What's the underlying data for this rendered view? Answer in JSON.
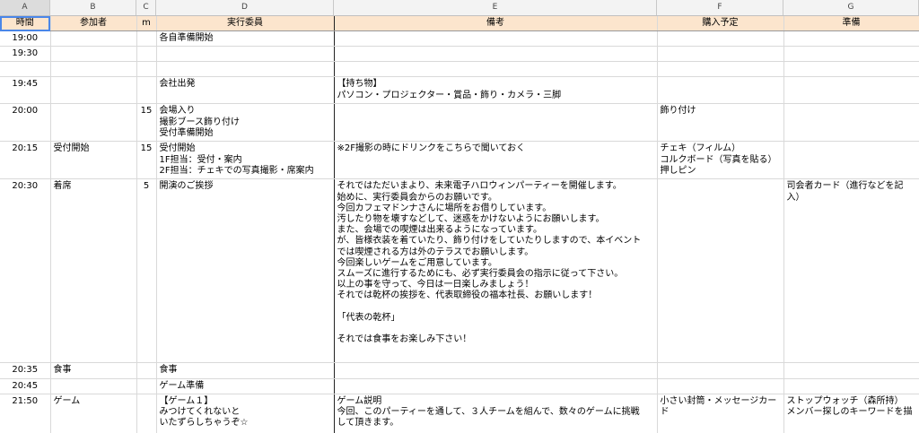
{
  "columns": [
    "A",
    "B",
    "C",
    "D",
    "E",
    "F",
    "G"
  ],
  "headers": [
    "時間",
    "参加者",
    "m",
    "実行委員",
    "備考",
    "購入予定",
    "準備"
  ],
  "rows": [
    {
      "time": "19:00",
      "participants": "",
      "m": "",
      "committee": "各自準備開始",
      "notes": "",
      "purchase": "",
      "prep": ""
    },
    {
      "time": "19:30",
      "participants": "",
      "m": "",
      "committee": "",
      "notes": "",
      "purchase": "",
      "prep": ""
    },
    {
      "time": "",
      "participants": "",
      "m": "",
      "committee": "",
      "notes": "",
      "purchase": "",
      "prep": ""
    },
    {
      "time": "19:45",
      "participants": "",
      "m": "",
      "committee": "会社出発",
      "notes": "【持ち物】\nパソコン・プロジェクター・賞品・飾り・カメラ・三脚",
      "purchase": "",
      "prep": ""
    },
    {
      "time": "20:00",
      "participants": "",
      "m": "15",
      "committee": "会場入り\n撮影ブース飾り付け\n受付準備開始",
      "notes": "",
      "purchase": "飾り付け",
      "prep": ""
    },
    {
      "time": "20:15",
      "participants": "受付開始",
      "m": "15",
      "committee": "受付開始\n1F担当：受付・案内\n2F担当：チェキでの写真撮影・席案内",
      "notes": "※2F撮影の時にドリンクをこちらで聞いておく",
      "purchase": "チェキ（フィルム）\nコルクボード（写真を貼る）\n押しピン",
      "prep": ""
    },
    {
      "time": "20:30",
      "participants": "着席",
      "m": "5",
      "committee": "開演のご挨拶",
      "notes": "それではただいまより、未来電子ハロウィンパーティーを開催します。\n始めに、実行委員会からのお願いです。\n今回カフェマドンナさんに場所をお借りしています。\n汚したり物を壊すなどして、迷惑をかけないようにお願いします。\nまた、会場での喫煙は出来るようになっています。\nが、皆様衣装を着ていたり、飾り付けをしていたりしますので、本イベント\nでは喫煙される方は外のテラスでお願いします。\n今回楽しいゲームをご用意しています。\nスムーズに進行するためにも、必ず実行委員会の指示に従って下さい。\n以上の事を守って、今日は一日楽しみましょう！\nそれでは乾杯の挨拶を、代表取締役の福本社長、お願いします！\n\n「代表の乾杯」\n\nそれでは食事をお楽しみ下さい！",
      "purchase": "",
      "prep": "司会者カード（進行などを記\n入）"
    },
    {
      "time": "20:35",
      "participants": "食事",
      "m": "",
      "committee": "食事",
      "notes": "",
      "purchase": "",
      "prep": ""
    },
    {
      "time": "20:45",
      "participants": "",
      "m": "",
      "committee": "ゲーム準備",
      "notes": "",
      "purchase": "",
      "prep": ""
    },
    {
      "time": "21:50",
      "participants": "ゲーム",
      "m": "",
      "committee": "【ゲーム１】\nみつけてくれないと\nいたずらしちゃうぞ☆",
      "notes": "ゲーム説明\n今回、このパーティーを通して、３人チームを組んで、数々のゲームに挑戦\nして頂きます。",
      "purchase": "小さい封筒・メッセージカード",
      "prep": "ストップウォッチ（森所持）\nメンバー探しのキーワードを描"
    }
  ]
}
